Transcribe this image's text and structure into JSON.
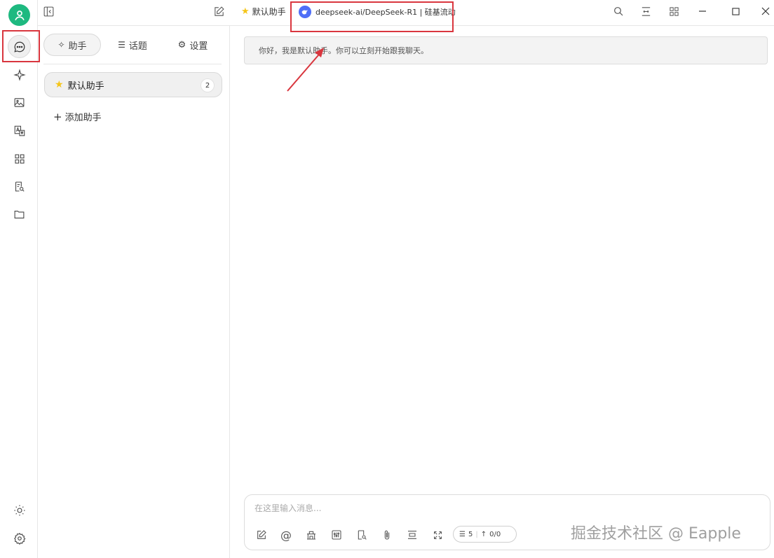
{
  "sidebar": {
    "avatar_icon": "user-icon",
    "items": [
      {
        "icon": "chat-bubble-icon",
        "active": true
      },
      {
        "icon": "sparkle-icon"
      },
      {
        "icon": "image-icon"
      },
      {
        "icon": "translate-icon"
      },
      {
        "icon": "apps-grid-icon"
      },
      {
        "icon": "knowledge-search-icon"
      },
      {
        "icon": "folder-icon"
      }
    ],
    "bottom": [
      {
        "icon": "sun-icon"
      },
      {
        "icon": "settings-icon"
      }
    ]
  },
  "panel": {
    "tabs": [
      {
        "label": "助手",
        "icon": "sparkle-icon",
        "active": true
      },
      {
        "label": "话题",
        "icon": "list-icon"
      },
      {
        "label": "设置",
        "icon": "gear-icon"
      }
    ],
    "assistant": {
      "name": "默认助手",
      "count": "2"
    },
    "add_label": "添加助手"
  },
  "topbar": {
    "assistant_name": "默认助手",
    "model_label": "deepseek-ai/DeepSeek-R1 | 硅基流动"
  },
  "chat": {
    "greeting": "你好，我是默认助手。你可以立刻开始跟我聊天。",
    "input_placeholder": "在这里输入消息...",
    "context_count": "5",
    "token_count": "0/0"
  },
  "watermark": "掘金技术社区 @ Eapple",
  "colors": {
    "accent_green": "#1eb980",
    "highlight_red": "#d9363e",
    "star_yellow": "#f5c518"
  }
}
